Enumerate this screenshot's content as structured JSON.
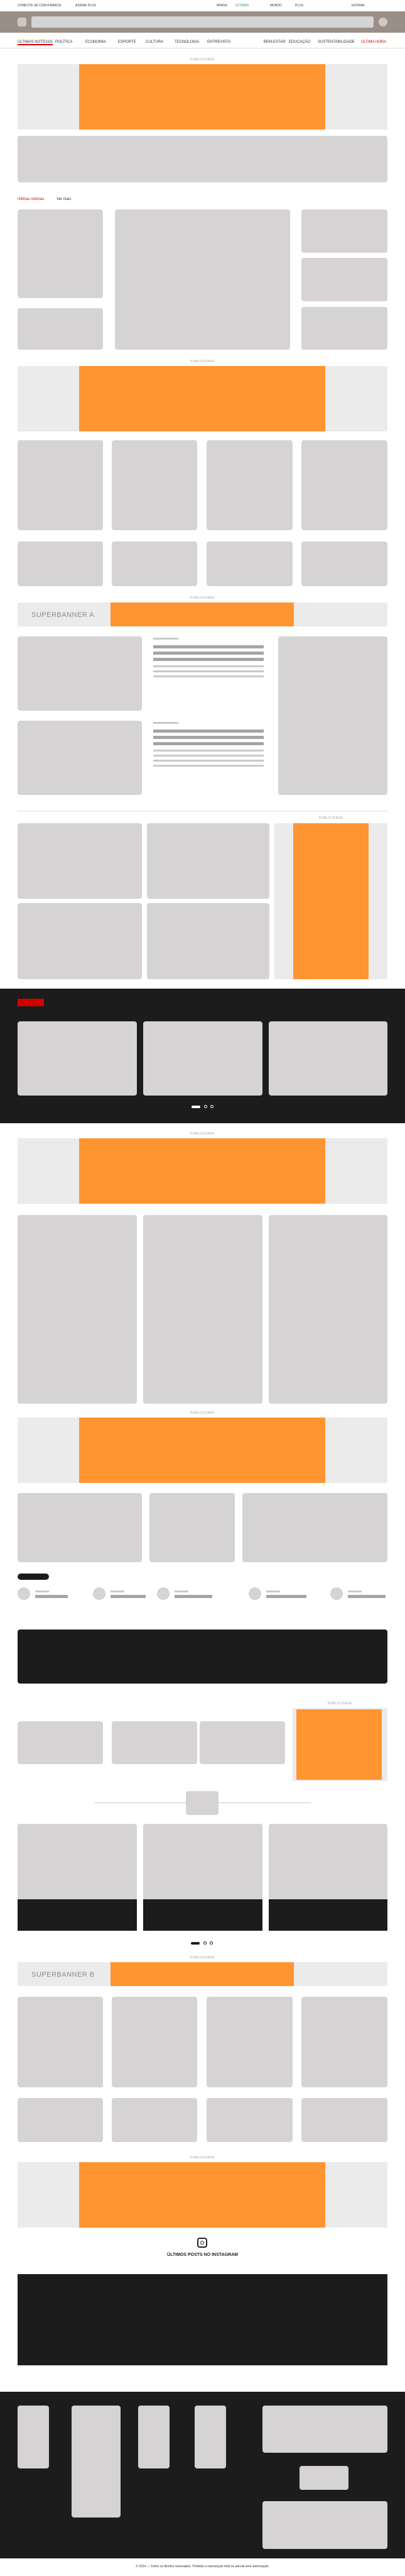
{
  "topbar": {
    "left_label": "CONECTE-SE COM A MARCA",
    "left_label2": "ASSINE PLUS",
    "items": [
      "BRASIL",
      "MUNDO",
      "PLUS",
      "ENTRAR"
    ],
    "highlight": "ÚLTIMAS"
  },
  "nav": {
    "items": [
      "ÚLTIMAS NOTÍCIAS",
      "POLÍTICA",
      "ECONOMIA",
      "ESPORTE",
      "CULTURA",
      "TECNOLOGIA",
      "ENTREVISTA",
      "BEM-ESTAR",
      "EDUCAÇÃO",
      "SUSTENTABILIDADE",
      "ÚLTIMA HORA"
    ]
  },
  "ads": {
    "label": "PUBLICIDADE"
  },
  "section_header": {
    "tag": "Últimas notícias",
    "link": "Ver mais"
  },
  "superbanners": {
    "a": "SUPERBANNER A",
    "b": "SUPERBANNER B"
  },
  "instagram": {
    "title": "ÚLTIMOS POSTS NO INSTAGRAM",
    "icon": "instagram-icon"
  },
  "footer": {
    "copyright": "© 2024 — Todos os direitos reservados. Proibida a reprodução total ou parcial sem autorização."
  },
  "colors": {
    "accent": "#ff9531",
    "brand_red": "#d40000",
    "dark": "#1c1c1c",
    "placeholder": "#d5d3d3"
  }
}
